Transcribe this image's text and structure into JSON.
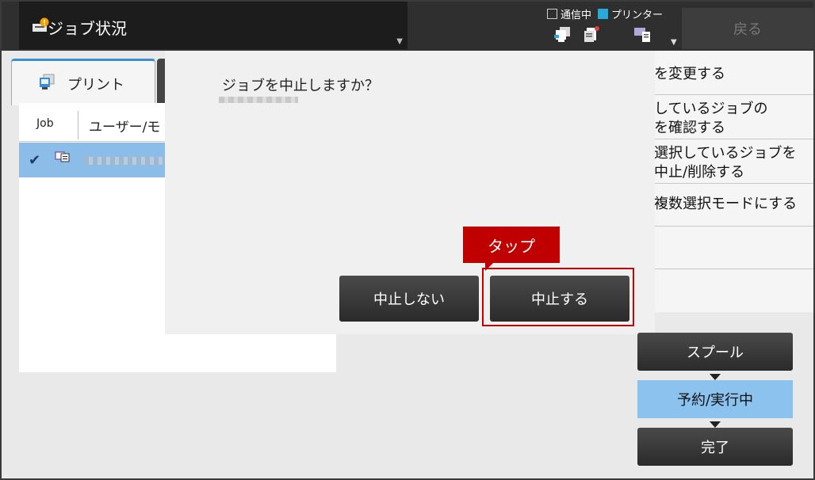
{
  "header": {
    "title": "ジョブ状況",
    "legend_comm": "通信中",
    "legend_printer": "プリンター",
    "back_label": "戻る"
  },
  "tabs": [
    {
      "label": "プリント"
    }
  ],
  "table": {
    "columns": [
      "Job",
      "ユーザー/モ"
    ],
    "rows": [
      {
        "icon_label": "RGB"
      }
    ]
  },
  "menu": {
    "items": [
      {
        "line1": "を変更する"
      },
      {
        "line1": "しているジョブの",
        "line2": "を確認する"
      },
      {
        "line1": "選択しているジョブを",
        "line2": "中止/削除する"
      },
      {
        "line1": "複数選択モードにする"
      }
    ]
  },
  "dialog": {
    "message": "ジョブを中止しますか？",
    "cancel_label": "中止しない",
    "confirm_label": "中止する"
  },
  "callout": {
    "label": "タップ"
  },
  "flow": {
    "steps": [
      "スプール",
      "予約/実行中",
      "完了"
    ],
    "active_step": "予約/実行中"
  },
  "colors": {
    "accent_blue": "#8cc2ee",
    "highlight_red": "#c00000",
    "legend_cyan": "#29a9d8"
  }
}
